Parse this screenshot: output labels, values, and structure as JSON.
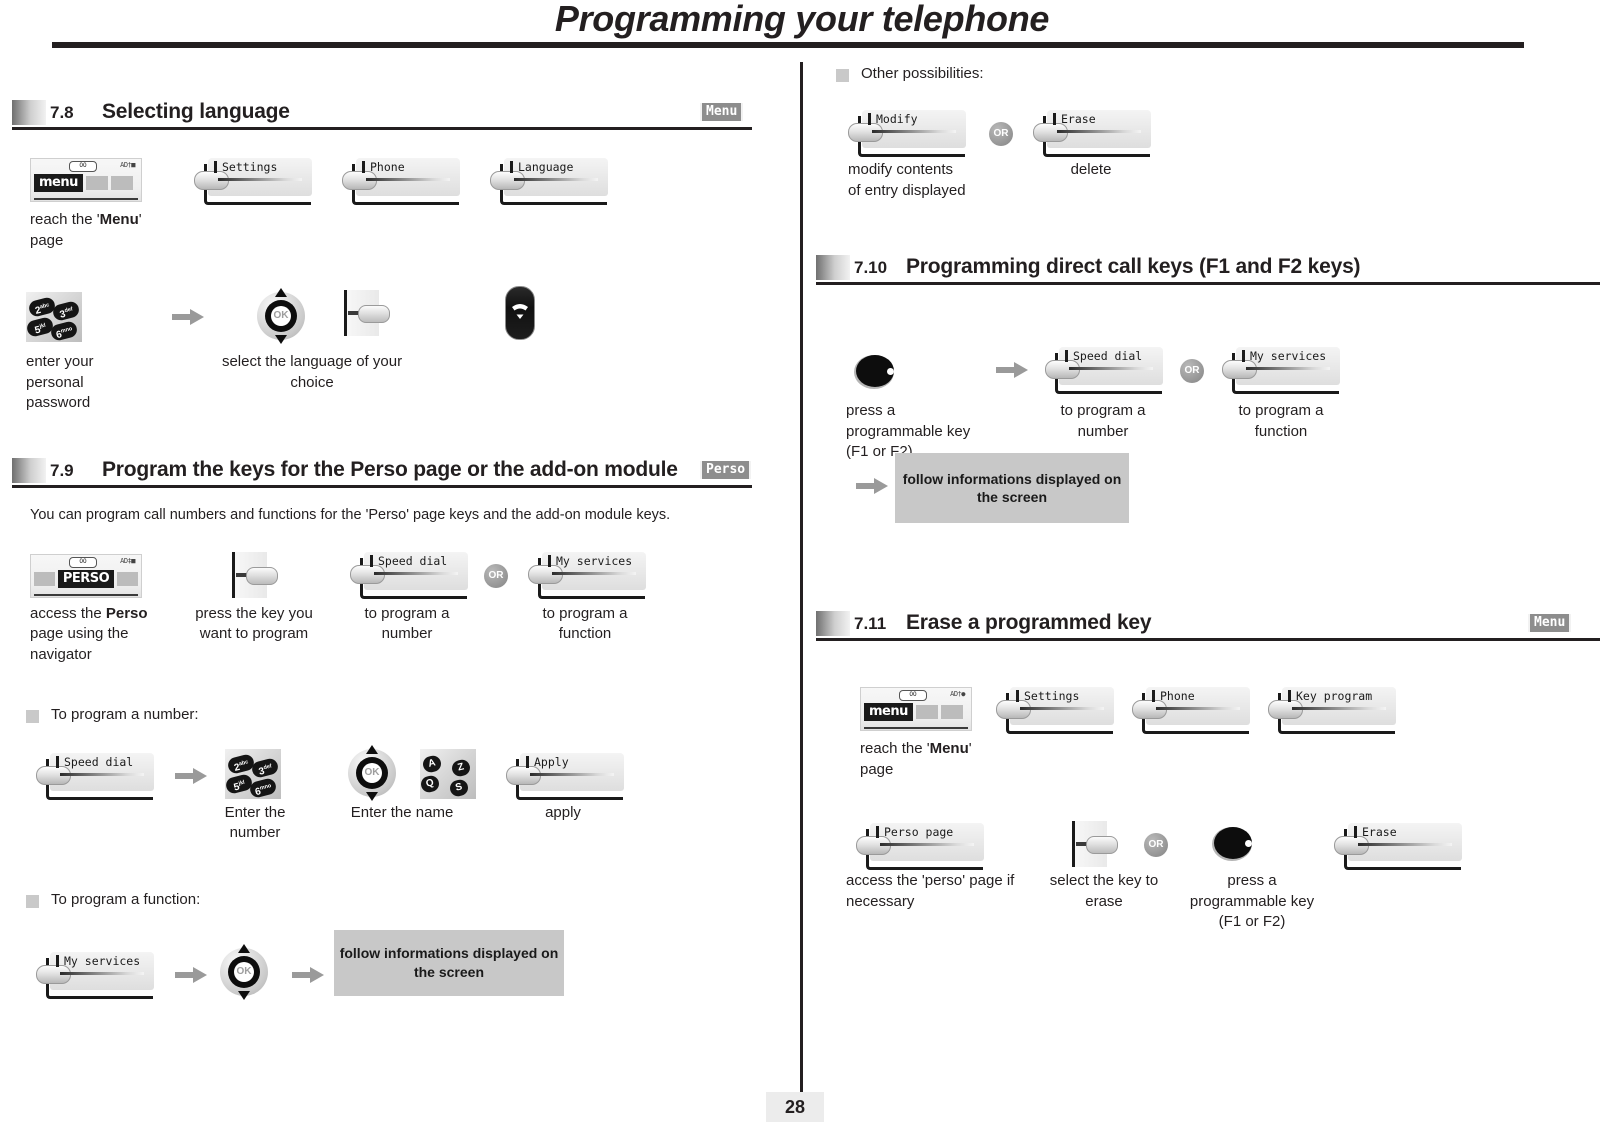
{
  "header": {
    "title": "Programming your telephone"
  },
  "page_number": "28",
  "colors": {
    "ink": "#231f20",
    "badge_bg": "#8d8d8d",
    "infobox_bg": "#c8c8c8",
    "arrow": "#9a9a9a"
  },
  "left_column": {
    "section_7_8": {
      "number": "7.8",
      "title": "Selecting language",
      "badge": "Menu",
      "row1": {
        "lcd": {
          "tag": "menu",
          "top_icon": "OO",
          "status_icons": "AD†■"
        },
        "softkeys": [
          "Settings",
          "Phone",
          "Language"
        ],
        "caption_prefix": "reach the '",
        "caption_bold": "Menu",
        "caption_suffix": "'",
        "caption_line2": "page"
      },
      "row2": {
        "keypad_keys": [
          {
            "digit": "2",
            "letters": "abc"
          },
          {
            "digit": "3",
            "letters": "def"
          },
          {
            "digit": "5",
            "letters": "jkl"
          },
          {
            "digit": "6",
            "letters": "mno"
          }
        ],
        "caption_keypad": "enter your\npersonal\npassword",
        "navigator_label": "OK",
        "caption_navigator": "select the language of your\nchoice",
        "hangup_icon": "hangup-key"
      }
    },
    "section_7_9": {
      "number": "7.9",
      "title": "Program the keys for the Perso page or the add-on module",
      "badge": "Perso",
      "intro": "You can program call numbers and functions for the 'Perso' page keys and the add-on module keys.",
      "row1": {
        "lcd": {
          "tag": "PERSO",
          "top_icon": "OO",
          "status_icons": "AD‡■"
        },
        "caption_lcd_line1_prefix": "access the ",
        "caption_lcd_bold": "Perso",
        "caption_lcd_line2": "page using the",
        "caption_lcd_line3": "navigator",
        "caption_selectkey": "press the key you\nwant to program",
        "softkey_number": "Speed dial",
        "caption_number": "to program a\nnumber",
        "or": "OR",
        "softkey_function": "My services",
        "caption_function": "to program a\nfunction"
      },
      "bullet_number": "To program a number:",
      "program_number_row": {
        "softkey": "Speed dial",
        "keypad_keys": [
          {
            "digit": "2",
            "letters": "abc"
          },
          {
            "digit": "3",
            "letters": "def"
          },
          {
            "digit": "5",
            "letters": "jkl"
          },
          {
            "digit": "6",
            "letters": "mno"
          }
        ],
        "caption_keypad": "Enter the\nnumber",
        "navigator_label": "OK",
        "alpha_keys": [
          "A",
          "Z",
          "Q",
          "S"
        ],
        "caption_alpha": "Enter the name",
        "softkey_apply": "Apply",
        "caption_apply": "apply"
      },
      "bullet_function": "To program a function:",
      "program_function_row": {
        "softkey": "My services",
        "navigator_label": "OK",
        "infobox": "follow informations displayed on the screen"
      }
    }
  },
  "right_column": {
    "other_possibilities": {
      "bullet": "Other possibilities:",
      "softkey_modify": "Modify",
      "or": "OR",
      "softkey_erase": "Erase",
      "caption_modify": "modify contents\nof entry displayed",
      "caption_erase": "delete"
    },
    "section_7_10": {
      "number": "7.10",
      "title": "Programming direct call keys (F1 and F2 keys)",
      "badge": "",
      "row1": {
        "progkey_icon": "programmable-key",
        "caption_progkey": "press a\nprogrammable key\n(F1 or F2)",
        "softkey_number": "Speed dial",
        "caption_number": "to program a\nnumber",
        "or": "OR",
        "softkey_function": "My services",
        "caption_function": "to program a\nfunction"
      },
      "row2": {
        "infobox": "follow informations displayed on the screen"
      }
    },
    "section_7_11": {
      "number": "7.11",
      "title": "Erase a programmed key",
      "badge": "Menu",
      "row1": {
        "lcd": {
          "tag": "menu",
          "top_icon": "OO",
          "status_icons": "AD†●"
        },
        "softkeys": [
          "Settings",
          "Phone",
          "Key program"
        ],
        "caption_prefix": "reach the '",
        "caption_bold": "Menu",
        "caption_suffix": "'",
        "caption_line2": "page"
      },
      "row2": {
        "softkey_perso": "Perso page",
        "caption_perso": "access the 'perso' page if\nnecessary",
        "caption_selectkey": "select the key to\nerase",
        "or": "OR",
        "caption_progkey": "press a\nprogrammable key\n(F1 or F2)",
        "softkey_erase": "Erase"
      }
    }
  }
}
